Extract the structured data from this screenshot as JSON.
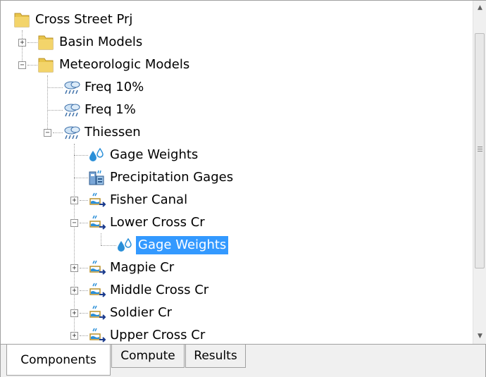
{
  "tree": {
    "root": {
      "label": "Cross Street Prj",
      "icon": "folder-icon"
    },
    "basin_models": {
      "label": "Basin Models",
      "icon": "folder-icon",
      "expander": "+"
    },
    "meteorologic_models": {
      "label": "Meteorologic Models",
      "icon": "folder-icon",
      "expander": "−"
    },
    "freq10": {
      "label": "Freq 10%",
      "icon": "rain-cloud-icon"
    },
    "freq1": {
      "label": "Freq 1%",
      "icon": "rain-cloud-icon"
    },
    "thiessen": {
      "label": "Thiessen",
      "icon": "rain-cloud-icon",
      "expander": "−"
    },
    "gage_weights": {
      "label": "Gage Weights",
      "icon": "water-drops-icon"
    },
    "precip_gages": {
      "label": "Precipitation Gages",
      "icon": "gage-station-icon"
    },
    "fisher_canal": {
      "label": "Fisher Canal",
      "icon": "subbasin-icon",
      "expander": "+"
    },
    "lower_cross": {
      "label": "Lower Cross Cr",
      "icon": "subbasin-icon",
      "expander": "−"
    },
    "lower_cross_gage_weights": {
      "label": "Gage Weights",
      "icon": "water-drops-icon",
      "selected": true
    },
    "magpie": {
      "label": "Magpie Cr",
      "icon": "subbasin-icon",
      "expander": "+"
    },
    "middle_cross": {
      "label": "Middle Cross Cr",
      "icon": "subbasin-icon",
      "expander": "+"
    },
    "soldier": {
      "label": "Soldier Cr",
      "icon": "subbasin-icon",
      "expander": "+"
    },
    "upper_cross": {
      "label": "Upper Cross Cr",
      "icon": "subbasin-icon",
      "expander": "+"
    }
  },
  "tabs": {
    "components": "Components",
    "compute": "Compute",
    "results": "Results",
    "active": "Components"
  },
  "scrollbar": {
    "up_glyph": "▲",
    "down_glyph": "▼"
  },
  "colors": {
    "selection": "#3399ff",
    "folder": "#e8c44a",
    "drop": "#2a8fd8"
  }
}
